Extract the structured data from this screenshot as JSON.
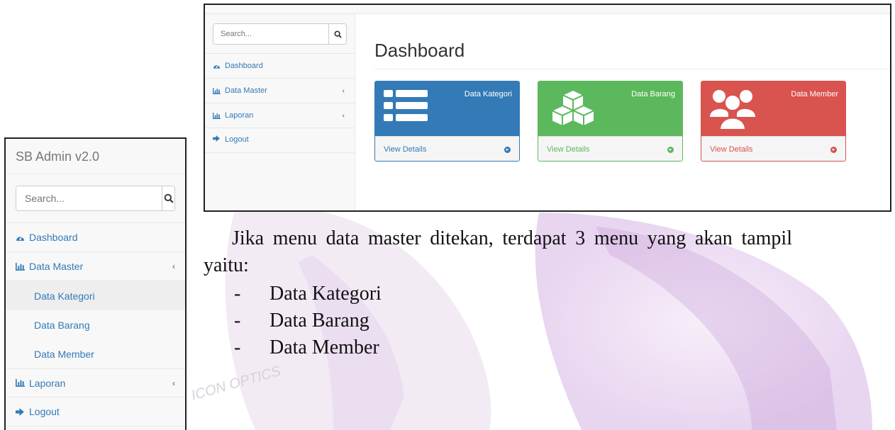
{
  "left_screenshot": {
    "brand": "SB Admin v2.0",
    "search": {
      "placeholder": "Search..."
    },
    "nav": {
      "dashboard": "Dashboard",
      "data_master": "Data Master",
      "data_master_chevron": "‹",
      "submenu": [
        "Data Kategori",
        "Data Barang",
        "Data Member"
      ],
      "laporan": "Laporan",
      "laporan_chevron": "‹",
      "logout": "Logout"
    }
  },
  "top_screenshot": {
    "search": {
      "placeholder": "Search..."
    },
    "nav": {
      "dashboard": "Dashboard",
      "data_master": "Data Master",
      "laporan": "Laporan",
      "logout": "Logout",
      "chevron": "‹"
    },
    "page_title": "Dashboard",
    "panels": [
      {
        "title": "Data Kategori",
        "link": "View Details",
        "color": "#337ab7",
        "icon": "list-icon"
      },
      {
        "title": "Data Barang",
        "link": "View Details",
        "color": "#5cb85c",
        "icon": "cubes-icon"
      },
      {
        "title": "Data Member",
        "link": "View Details",
        "color": "#d9534f",
        "icon": "users-icon"
      }
    ]
  },
  "document": {
    "paragraph": "Jika menu data master ditekan, terdapat 3 menu yang akan tampil yaitu:",
    "bullet_marker": "-",
    "bullets": [
      "Data Kategori",
      "Data Barang",
      "Data Member"
    ]
  },
  "watermark": {
    "text": "ICON OPTICS"
  },
  "colors": {
    "link": "#337ab7",
    "primary": "#337ab7",
    "success": "#5cb85c",
    "danger": "#d9534f"
  }
}
